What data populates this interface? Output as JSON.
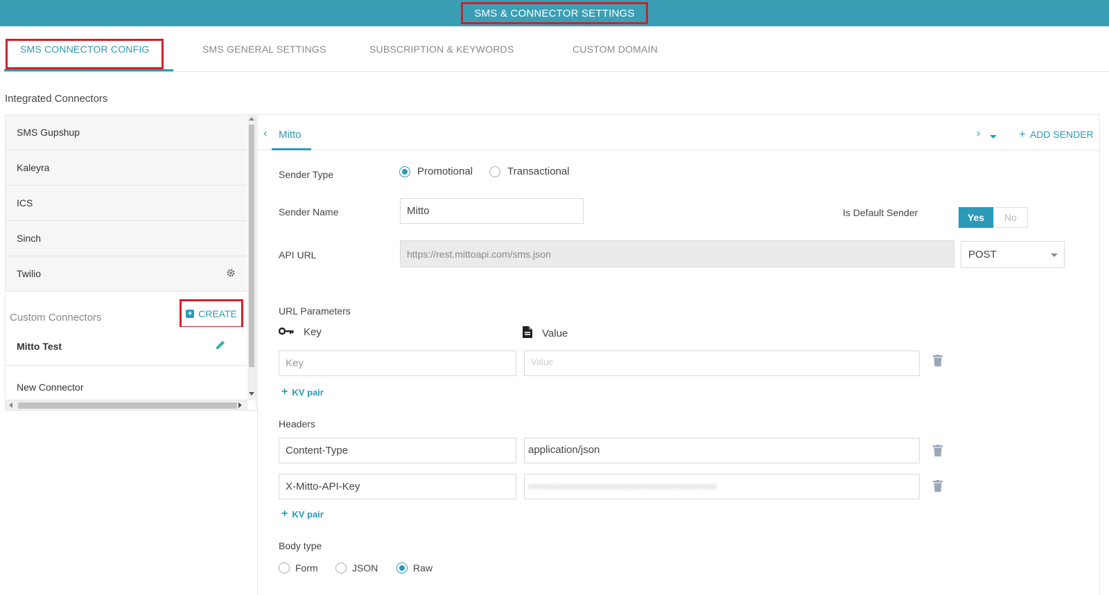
{
  "header": {
    "title": "SMS & CONNECTOR SETTINGS"
  },
  "tabs": [
    {
      "label": "SMS CONNECTOR CONFIG",
      "active": true
    },
    {
      "label": "SMS GENERAL SETTINGS",
      "active": false
    },
    {
      "label": "SUBSCRIPTION & KEYWORDS",
      "active": false
    },
    {
      "label": "CUSTOM DOMAIN",
      "active": false
    }
  ],
  "sidebar": {
    "title": "Integrated Connectors",
    "integrated": [
      {
        "label": "SMS Gupshup"
      },
      {
        "label": "Kaleyra"
      },
      {
        "label": "ICS"
      },
      {
        "label": "Sinch"
      },
      {
        "label": "Twilio",
        "icon": "gear-icon"
      }
    ],
    "custom_title": "Custom Connectors",
    "create_label": "CREATE",
    "custom": [
      {
        "label": "Mitto Test",
        "icon": "pencil-icon"
      },
      {
        "label": "New Connector"
      }
    ]
  },
  "panel": {
    "sender_tab": "Mitto",
    "add_sender_label": "ADD SENDER",
    "sender_type": {
      "label": "Sender Type",
      "options": [
        "Promotional",
        "Transactional"
      ],
      "selected": "Promotional"
    },
    "sender_name": {
      "label": "Sender Name",
      "value": "Mitto"
    },
    "is_default": {
      "label": "Is Default Sender",
      "yes": "Yes",
      "no": "No",
      "selected": "Yes"
    },
    "api_url": {
      "label": "API URL",
      "value": "https://rest.mittoapi.com/sms.json",
      "method": "POST"
    },
    "url_params": {
      "label": "URL Parameters",
      "key_header": "Key",
      "value_header": "Value",
      "rows": [
        {
          "key_placeholder": "Key",
          "value_placeholder": "Value"
        }
      ],
      "add_label": "KV pair"
    },
    "headers": {
      "label": "Headers",
      "rows": [
        {
          "key": "Content-Type",
          "value": "application/json"
        },
        {
          "key": "X-Mitto-API-Key",
          "value": "xxxxxxxxxxxxxxxxxxxxxxxxxxxxxxxxxxxxxxxx"
        }
      ],
      "add_label": "KV pair"
    },
    "body_type": {
      "label": "Body type",
      "options": [
        "Form",
        "JSON",
        "Raw"
      ],
      "selected": "Raw"
    }
  },
  "colors": {
    "accent": "#2a9ab8",
    "header_bg": "#3a9fb5",
    "highlight": "#d0202c"
  }
}
